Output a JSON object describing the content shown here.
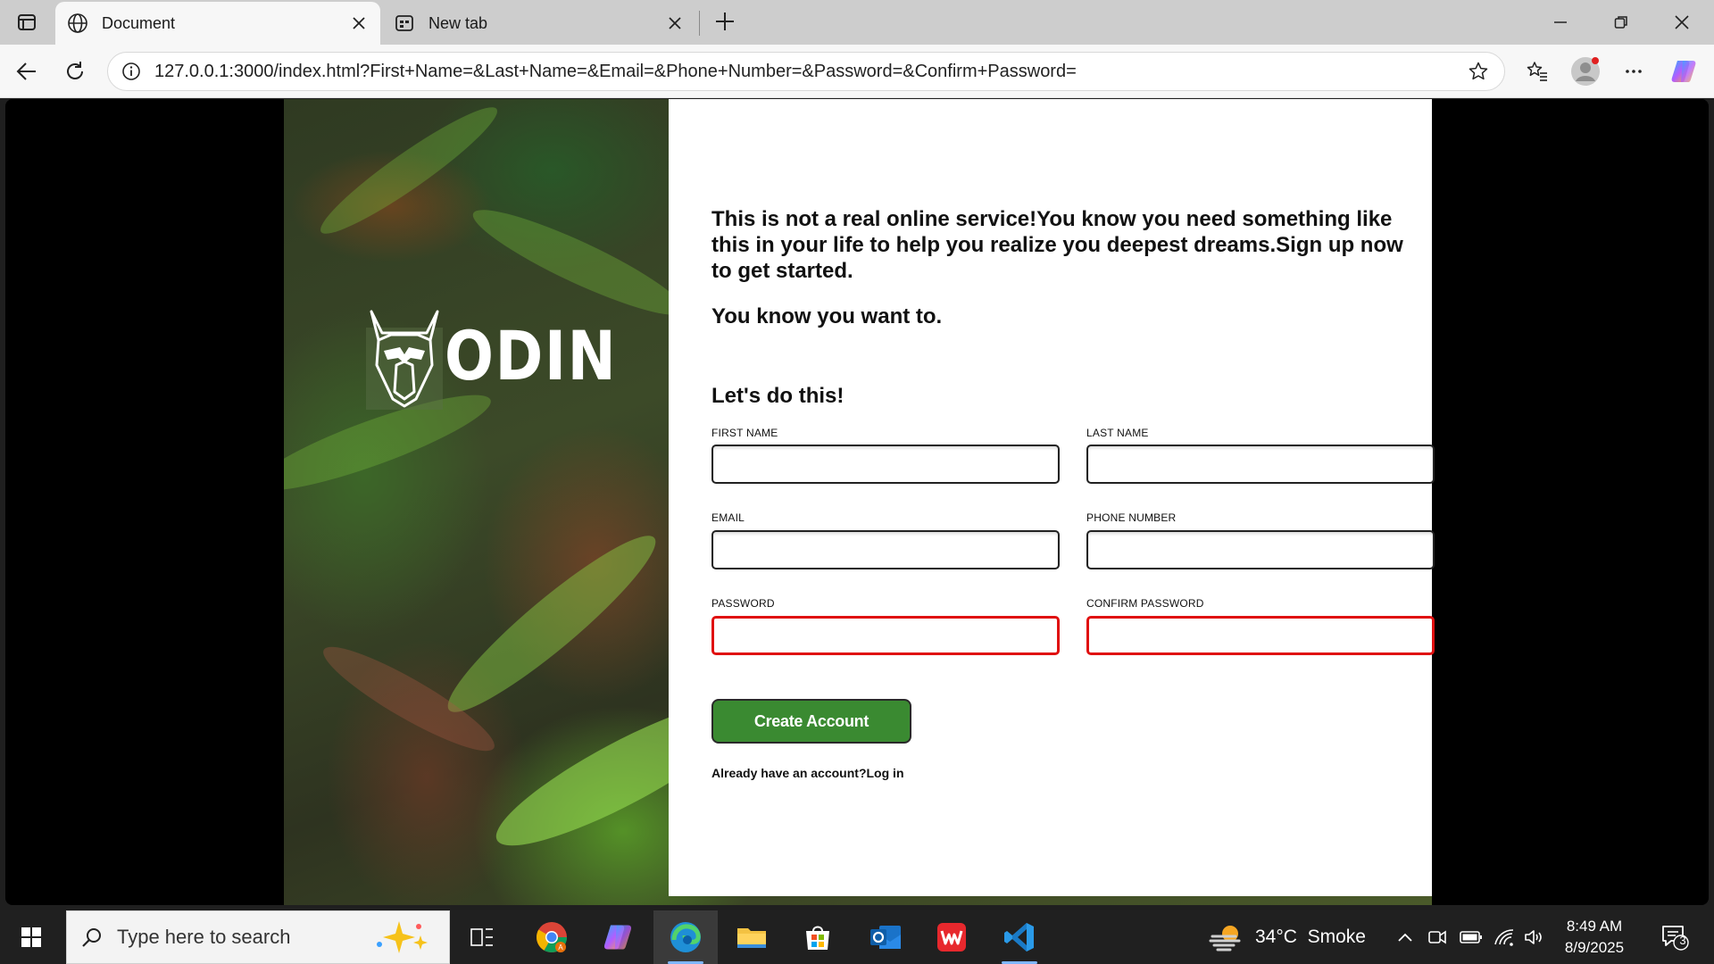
{
  "browser": {
    "tabs": [
      {
        "title": "Document",
        "active": true
      },
      {
        "title": "New tab",
        "active": false
      }
    ],
    "address": "127.0.0.1:3000/index.html?First+Name=&Last+Name=&Email=&Phone+Number=&Password=&Confirm+Password="
  },
  "page": {
    "logo_text": "ODIN",
    "intro": "This is not a real online service!You know you need something like this in your life to help you realize you deepest dreams.Sign up now to get started.",
    "intro2": "You know you want to.",
    "form_title": "Let's do this!",
    "fields": {
      "first_name": {
        "label": "FIRST NAME",
        "value": ""
      },
      "last_name": {
        "label": "LAST NAME",
        "value": ""
      },
      "email": {
        "label": "EMAIL",
        "value": ""
      },
      "phone": {
        "label": "PHONE NUMBER",
        "value": ""
      },
      "password": {
        "label": "PASSWORD",
        "value": "",
        "invalid": true
      },
      "confirm_password": {
        "label": "CONFIRM PASSWORD",
        "value": "",
        "invalid": true
      }
    },
    "submit_label": "Create Account",
    "login_prompt": "Already have an account?Log in",
    "invalid_color": "#e01010",
    "button_color": "#3a8a31"
  },
  "taskbar": {
    "search_placeholder": "Type here to search",
    "weather": "34°C  Smoke",
    "time": "8:49 AM",
    "date": "8/9/2025",
    "notification_count": "3",
    "apps": [
      "task-view",
      "chrome",
      "copilot",
      "edge",
      "file-explorer",
      "microsoft-store",
      "outlook",
      "wps-office",
      "vscode"
    ]
  }
}
